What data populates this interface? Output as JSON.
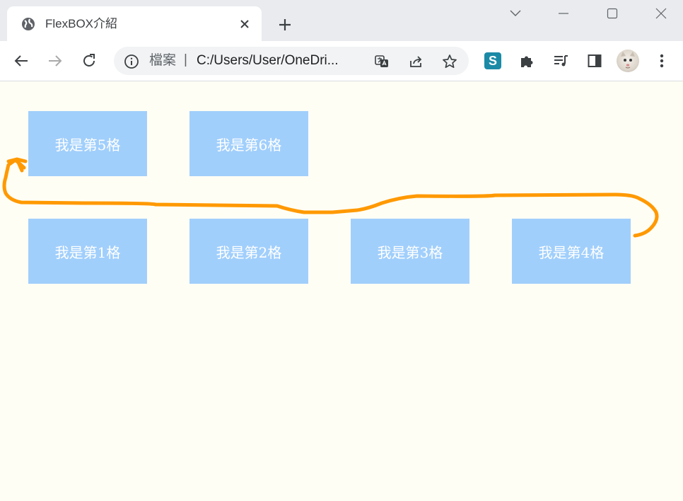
{
  "browser": {
    "tab_title": "FlexBOX介紹",
    "address_scheme": "檔案",
    "address_separator": "|",
    "address_url": "C:/Users/User/OneDri...",
    "extension_label": "S"
  },
  "icons": {
    "tab_favicon": "globe-icon",
    "tab_close": "close-icon",
    "new_tab": "plus-icon",
    "window": [
      "chevron-down-icon",
      "minimize-icon",
      "maximize-icon",
      "close-window-icon"
    ],
    "toolbar": [
      "back-arrow-icon",
      "forward-arrow-icon",
      "reload-icon",
      "info-icon",
      "translate-icon",
      "share-icon",
      "star-icon",
      "puzzle-icon",
      "media-queue-icon",
      "side-panel-icon",
      "avatar",
      "more-vertical-icon"
    ]
  },
  "page": {
    "background": "#fffef5",
    "box_color": "#a1cffc",
    "annotation_color": "#ff9900",
    "row_top": [
      "我是第5格",
      "我是第6格"
    ],
    "row_bottom": [
      "我是第1格",
      "我是第2格",
      "我是第3格",
      "我是第4格"
    ]
  }
}
